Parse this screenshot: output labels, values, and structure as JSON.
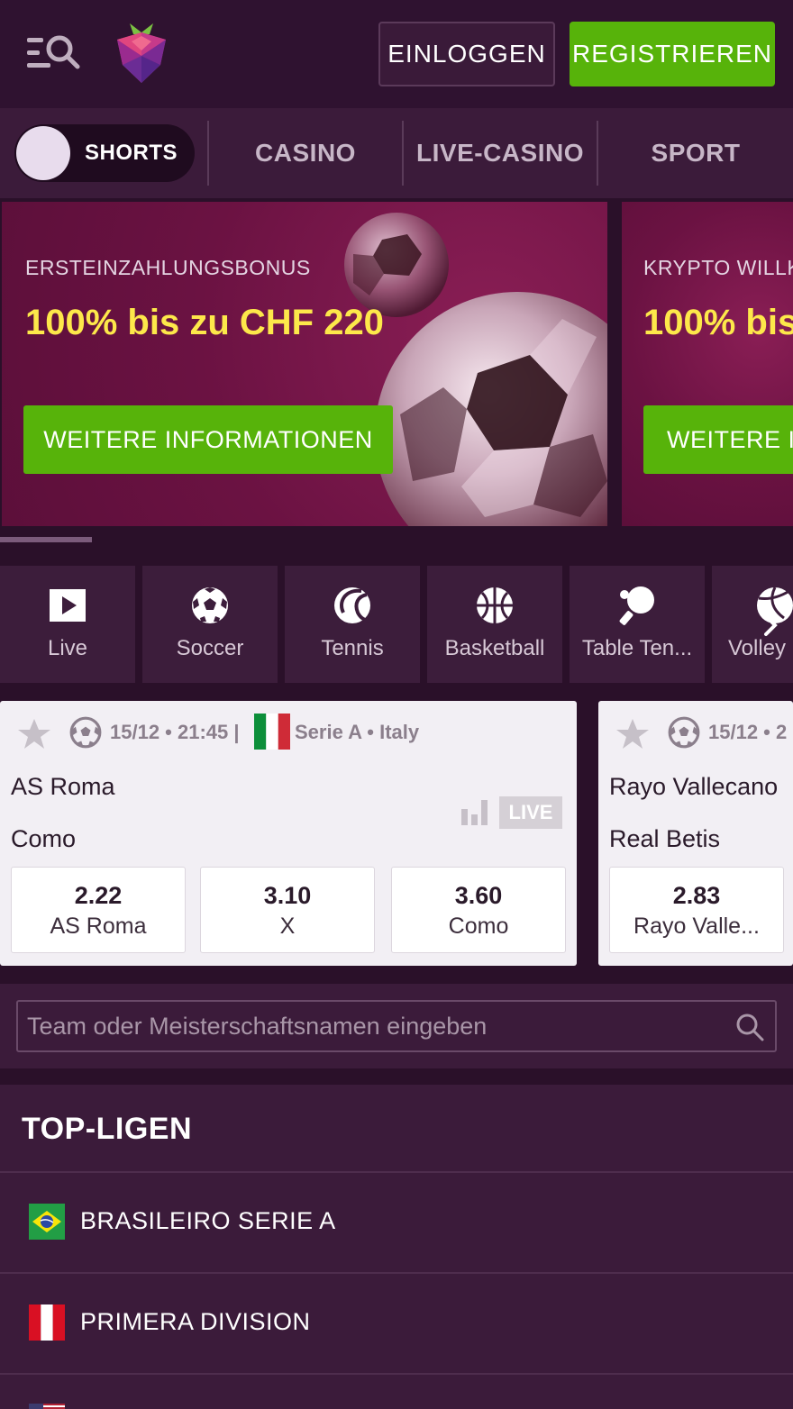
{
  "header": {
    "login_label": "EINLOGGEN",
    "register_label": "REGISTRIEREN"
  },
  "nav": {
    "shorts_label": "SHORTS",
    "items": [
      "CASINO",
      "LIVE-CASINO",
      "SPORT"
    ]
  },
  "banners": [
    {
      "subtitle": "ERSTEINZAHLUNGSBONUS",
      "title": "100% bis zu CHF 220",
      "button": "WEITERE INFORMATIONEN"
    },
    {
      "subtitle": "KRYPTO WILLK",
      "title": "100% bis",
      "button": "WEITERE IN"
    }
  ],
  "sports": [
    {
      "label": "Live",
      "icon": "play-icon"
    },
    {
      "label": "Soccer",
      "icon": "soccer-ball-icon"
    },
    {
      "label": "Tennis",
      "icon": "tennis-ball-icon"
    },
    {
      "label": "Basketball",
      "icon": "basketball-icon"
    },
    {
      "label": "Table Ten...",
      "icon": "table-tennis-icon"
    },
    {
      "label": "Volley",
      "icon": "volleyball-icon"
    }
  ],
  "matches": [
    {
      "datetime": "15/12 • 21:45 |",
      "league": "Serie A  •  Italy",
      "home": "AS Roma",
      "away": "Como",
      "live": "LIVE",
      "odds": [
        {
          "value": "2.22",
          "label": "AS Roma"
        },
        {
          "value": "3.10",
          "label": "X"
        },
        {
          "value": "3.60",
          "label": "Como"
        }
      ]
    },
    {
      "datetime": "15/12 • 2",
      "home": "Rayo Vallecano",
      "away": "Real Betis",
      "odds": [
        {
          "value": "2.83",
          "label": "Rayo Valle..."
        }
      ]
    }
  ],
  "search": {
    "placeholder": "Team oder Meisterschaftsnamen eingeben"
  },
  "top_leagues": {
    "title": "TOP-LIGEN",
    "items": [
      {
        "name": "BRASILEIRO SERIE A",
        "flag": "brazil-flag"
      },
      {
        "name": "PRIMERA DIVISION",
        "flag": "peru-flag"
      }
    ]
  },
  "colors": {
    "accent_green": "#57b30a",
    "banner_title_yellow": "#fde84a",
    "background": "#2a1029"
  }
}
